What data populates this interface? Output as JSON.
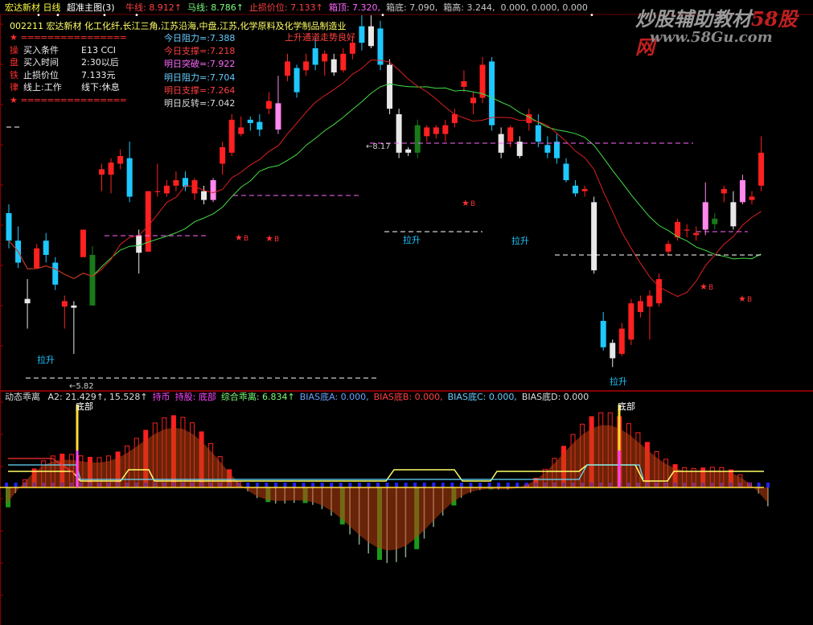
{
  "header": {
    "title": "宏达新材 日线",
    "main_chart_name": "超准主图(3)",
    "indicators": [
      {
        "label": "牛线:",
        "value": "8.912↑",
        "color": "#ff4040"
      },
      {
        "label": "马线:",
        "value": "8.786↑",
        "color": "#7cfc7c"
      },
      {
        "label": "止损价位:",
        "value": "7.133↑",
        "color": "#ff4040"
      },
      {
        "label": "箱顶:",
        "value": "7.320,",
        "color": "#ff66ff"
      },
      {
        "label": "箱底:",
        "value": "7.090,",
        "color": "#c8c8c8"
      },
      {
        "label": "箱高:",
        "value": "3.244,",
        "color": "#c8c8c8"
      },
      {
        "label": "",
        "value": "0.000, 0.000, 0.000",
        "color": "#c8c8c8"
      }
    ]
  },
  "stock_info": {
    "line": "002211 宏达新材 化工化纤,长江三角,江苏沿海,中盘,江苏,化学原料及化学制品制造业",
    "trend_note": "上升通道走势良好"
  },
  "info_panel": {
    "separator": "================",
    "rows": [
      {
        "icon": "操",
        "label": "买入条件",
        "value": "E13 CCI"
      },
      {
        "icon": "盘",
        "label": "买入时间",
        "value": "2:30以后"
      },
      {
        "icon": "铁",
        "label": "止损价位",
        "value": "7.133元"
      },
      {
        "icon": "律",
        "label": "线上:工作",
        "value": "线下:休息"
      }
    ]
  },
  "levels_panel": [
    {
      "text": "今日阻力=:7.388",
      "color": "#66ccff"
    },
    {
      "text": "今日支撑=:7.218",
      "color": "#ff4040"
    },
    {
      "text": "明日突破=:7.922",
      "color": "#ff66ff"
    },
    {
      "text": "明日阻力=:7.704",
      "color": "#66ccff"
    },
    {
      "text": "明日支撑=:7.264",
      "color": "#ff4040"
    },
    {
      "text": "明日反转=:7.042",
      "color": "#dddddd"
    }
  ],
  "price_marks": {
    "high": "8.17",
    "low": "5.82"
  },
  "signal_labels": {
    "lift": "拉升",
    "buy": "B",
    "bottom": "底部"
  },
  "lower_panel": {
    "name": "动态乖离",
    "values": [
      {
        "label": "A2:",
        "value": "21.429↑, 15.528↑",
        "color": "#dddddd"
      },
      {
        "label": "",
        "value": "持币",
        "color": "#ff44ff"
      },
      {
        "label": "持股:",
        "value": "底部",
        "color": "#ff44ff"
      },
      {
        "label": "综合乖离:",
        "value": "6.834↑",
        "color": "#7cfc7c"
      },
      {
        "label": "BIAS底A:",
        "value": "0.000,",
        "color": "#66a3ff"
      },
      {
        "label": "BIAS底B:",
        "value": "0.000,",
        "color": "#ff4040"
      },
      {
        "label": "BIAS底C:",
        "value": "0.000,",
        "color": "#66ccff"
      },
      {
        "label": "BIAS底D:",
        "value": "0.000",
        "color": "#dddddd"
      }
    ]
  },
  "watermark": {
    "text1": "炒股辅助教材",
    "text2": "58股网",
    "url": "www.58Gu.com"
  },
  "chart_data": [
    {
      "type": "candlestick",
      "title": "宏达新材 日线",
      "series_note": "approximate OHLC per day read from candle positions",
      "candles": [
        {
          "o": 7.1,
          "h": 7.18,
          "l": 6.78,
          "c": 6.85,
          "col": "cyan"
        },
        {
          "o": 6.85,
          "h": 6.98,
          "l": 6.6,
          "c": 6.65,
          "col": "cyan"
        },
        {
          "o": 6.32,
          "h": 6.5,
          "l": 6.05,
          "c": 6.28,
          "col": "white"
        },
        {
          "o": 6.78,
          "h": 6.82,
          "l": 6.6,
          "c": 6.6,
          "col": "red"
        },
        {
          "o": 6.85,
          "h": 6.92,
          "l": 6.65,
          "c": 6.72,
          "col": "cyan"
        },
        {
          "o": 6.65,
          "h": 6.7,
          "l": 6.4,
          "c": 6.45,
          "col": "cyan"
        },
        {
          "o": 6.3,
          "h": 6.35,
          "l": 6.05,
          "c": 6.25,
          "col": "red"
        },
        {
          "o": 6.26,
          "h": 6.3,
          "l": 5.82,
          "c": 6.24,
          "col": "white"
        },
        {
          "o": 6.7,
          "h": 6.95,
          "l": 6.7,
          "c": 6.95,
          "col": "red"
        },
        {
          "o": 6.72,
          "h": 6.8,
          "l": 6.26,
          "c": 6.26,
          "col": "green"
        },
        {
          "o": 7.45,
          "h": 7.55,
          "l": 7.3,
          "c": 7.5,
          "col": "red"
        },
        {
          "o": 7.45,
          "h": 7.6,
          "l": 7.28,
          "c": 7.56,
          "col": "red"
        },
        {
          "o": 7.55,
          "h": 7.68,
          "l": 7.5,
          "c": 7.62,
          "col": "red"
        },
        {
          "o": 7.6,
          "h": 7.75,
          "l": 7.2,
          "c": 7.25,
          "col": "cyan"
        },
        {
          "o": 6.74,
          "h": 6.95,
          "l": 6.55,
          "c": 6.9,
          "col": "white"
        },
        {
          "o": 6.75,
          "h": 7.3,
          "l": 6.75,
          "c": 7.3,
          "col": "red"
        },
        {
          "o": 7.3,
          "h": 7.55,
          "l": 7.25,
          "c": 7.3,
          "col": "red"
        },
        {
          "o": 7.28,
          "h": 7.4,
          "l": 7.25,
          "c": 7.35,
          "col": "red"
        },
        {
          "o": 7.35,
          "h": 7.48,
          "l": 7.3,
          "c": 7.4,
          "col": "red"
        },
        {
          "o": 7.42,
          "h": 7.48,
          "l": 7.3,
          "c": 7.34,
          "col": "cyan"
        },
        {
          "o": 7.28,
          "h": 7.42,
          "l": 7.22,
          "c": 7.4,
          "col": "red"
        },
        {
          "o": 7.3,
          "h": 7.35,
          "l": 7.18,
          "c": 7.22,
          "col": "white"
        },
        {
          "o": 7.22,
          "h": 7.42,
          "l": 7.2,
          "c": 7.4,
          "col": "pink"
        },
        {
          "o": 7.7,
          "h": 7.75,
          "l": 7.45,
          "c": 7.55,
          "col": "red"
        },
        {
          "o": 7.65,
          "h": 8.0,
          "l": 7.62,
          "c": 7.95,
          "col": "red"
        },
        {
          "o": 7.88,
          "h": 7.98,
          "l": 7.8,
          "c": 7.82,
          "col": "red"
        },
        {
          "o": 7.92,
          "h": 7.98,
          "l": 7.85,
          "c": 7.95,
          "col": "cyan"
        },
        {
          "o": 7.93,
          "h": 8.0,
          "l": 7.8,
          "c": 7.86,
          "col": "cyan"
        },
        {
          "o": 8.05,
          "h": 8.2,
          "l": 8.0,
          "c": 8.12,
          "col": "red"
        },
        {
          "o": 8.1,
          "h": 8.35,
          "l": 7.82,
          "c": 7.86,
          "col": "pink"
        },
        {
          "o": 8.35,
          "h": 8.55,
          "l": 8.3,
          "c": 8.48,
          "col": "red"
        },
        {
          "o": 8.42,
          "h": 8.45,
          "l": 8.15,
          "c": 8.2,
          "col": "cyan"
        },
        {
          "o": 8.48,
          "h": 8.55,
          "l": 8.35,
          "c": 8.4,
          "col": "red"
        },
        {
          "o": 8.6,
          "h": 8.7,
          "l": 8.4,
          "c": 8.45,
          "col": "cyan"
        },
        {
          "o": 8.48,
          "h": 8.58,
          "l": 8.35,
          "c": 8.55,
          "col": "red"
        },
        {
          "o": 8.5,
          "h": 8.55,
          "l": 8.35,
          "c": 8.38,
          "col": "white"
        },
        {
          "o": 8.4,
          "h": 8.6,
          "l": 8.38,
          "c": 8.55,
          "col": "red"
        },
        {
          "o": 8.55,
          "h": 8.7,
          "l": 8.5,
          "c": 8.65,
          "col": "red"
        },
        {
          "o": 8.8,
          "h": 8.9,
          "l": 8.58,
          "c": 8.65,
          "col": "cyan"
        },
        {
          "o": 8.8,
          "h": 8.9,
          "l": 8.6,
          "c": 8.62,
          "col": "white"
        },
        {
          "o": 8.78,
          "h": 8.85,
          "l": 8.4,
          "c": 8.45,
          "col": "cyan"
        },
        {
          "o": 8.45,
          "h": 8.5,
          "l": 8.0,
          "c": 8.05,
          "col": "white"
        },
        {
          "o": 8.0,
          "h": 8.05,
          "l": 7.6,
          "c": 7.65,
          "col": "white"
        },
        {
          "o": 7.68,
          "h": 7.7,
          "l": 7.62,
          "c": 7.65,
          "col": "white"
        },
        {
          "o": 7.65,
          "h": 7.95,
          "l": 7.6,
          "c": 7.9,
          "col": "green"
        },
        {
          "o": 7.8,
          "h": 7.9,
          "l": 7.75,
          "c": 7.88,
          "col": "red"
        },
        {
          "o": 7.82,
          "h": 7.9,
          "l": 7.78,
          "c": 7.88,
          "col": "red"
        },
        {
          "o": 7.82,
          "h": 7.95,
          "l": 7.75,
          "c": 7.9,
          "col": "red"
        },
        {
          "o": 7.92,
          "h": 8.05,
          "l": 7.88,
          "c": 8.0,
          "col": "red"
        },
        {
          "o": 8.25,
          "h": 8.4,
          "l": 8.2,
          "c": 8.3,
          "col": "red"
        },
        {
          "o": 8.1,
          "h": 8.2,
          "l": 8.0,
          "c": 8.15,
          "col": "red"
        },
        {
          "o": 8.45,
          "h": 8.52,
          "l": 8.1,
          "c": 8.15,
          "col": "red"
        },
        {
          "o": 8.48,
          "h": 8.52,
          "l": 7.85,
          "c": 7.9,
          "col": "cyan"
        },
        {
          "o": 7.82,
          "h": 7.88,
          "l": 7.6,
          "c": 7.65,
          "col": "white"
        },
        {
          "o": 7.75,
          "h": 7.9,
          "l": 7.7,
          "c": 7.88,
          "col": "red"
        },
        {
          "o": 7.75,
          "h": 7.8,
          "l": 7.6,
          "c": 7.62,
          "col": "white"
        },
        {
          "o": 8.0,
          "h": 8.05,
          "l": 7.85,
          "c": 7.92,
          "col": "red"
        },
        {
          "o": 7.9,
          "h": 8.0,
          "l": 7.7,
          "c": 7.75,
          "col": "cyan"
        },
        {
          "o": 7.72,
          "h": 7.8,
          "l": 7.6,
          "c": 7.65,
          "col": "cyan"
        },
        {
          "o": 7.75,
          "h": 7.82,
          "l": 7.55,
          "c": 7.6,
          "col": "cyan"
        },
        {
          "o": 7.55,
          "h": 7.6,
          "l": 7.38,
          "c": 7.4,
          "col": "cyan"
        },
        {
          "o": 7.35,
          "h": 7.4,
          "l": 7.25,
          "c": 7.28,
          "col": "cyan"
        },
        {
          "o": 7.32,
          "h": 7.35,
          "l": 7.25,
          "c": 7.3,
          "col": "red"
        },
        {
          "o": 7.2,
          "h": 7.25,
          "l": 6.55,
          "c": 6.58,
          "col": "white"
        },
        {
          "o": 6.12,
          "h": 6.2,
          "l": 5.85,
          "c": 5.88,
          "col": "cyan"
        },
        {
          "o": 5.92,
          "h": 5.95,
          "l": 5.7,
          "c": 5.78,
          "col": "white"
        },
        {
          "o": 5.82,
          "h": 6.1,
          "l": 5.8,
          "c": 6.05,
          "col": "red"
        },
        {
          "o": 5.95,
          "h": 6.32,
          "l": 5.9,
          "c": 6.28,
          "col": "red"
        },
        {
          "o": 6.2,
          "h": 6.35,
          "l": 6.15,
          "c": 6.3,
          "col": "red"
        },
        {
          "o": 6.25,
          "h": 6.4,
          "l": 5.95,
          "c": 6.35,
          "col": "red"
        },
        {
          "o": 6.28,
          "h": 6.55,
          "l": 6.25,
          "c": 6.5,
          "col": "red"
        },
        {
          "o": 6.75,
          "h": 6.85,
          "l": 6.72,
          "c": 6.82,
          "col": "red"
        },
        {
          "o": 7.02,
          "h": 7.05,
          "l": 6.85,
          "c": 6.88,
          "col": "red"
        },
        {
          "o": 6.95,
          "h": 7.0,
          "l": 6.88,
          "c": 6.95,
          "col": "red"
        },
        {
          "o": 6.92,
          "h": 6.98,
          "l": 6.85,
          "c": 6.9,
          "col": "red"
        },
        {
          "o": 6.95,
          "h": 7.38,
          "l": 6.9,
          "c": 7.2,
          "col": "pink"
        },
        {
          "o": 7.05,
          "h": 7.1,
          "l": 6.95,
          "c": 7.0,
          "col": "green"
        },
        {
          "o": 7.32,
          "h": 7.35,
          "l": 7.2,
          "c": 7.28,
          "col": "red"
        },
        {
          "o": 7.2,
          "h": 7.3,
          "l": 6.95,
          "c": 6.98,
          "col": "white"
        },
        {
          "o": 7.2,
          "h": 7.45,
          "l": 7.18,
          "c": 7.4,
          "col": "pink"
        },
        {
          "o": 7.25,
          "h": 7.3,
          "l": 7.18,
          "c": 7.22,
          "col": "red"
        },
        {
          "o": 7.65,
          "h": 7.8,
          "l": 7.3,
          "c": 7.35,
          "col": "red"
        }
      ],
      "ma_note": "red and green moving averages",
      "ylim": [
        5.6,
        8.6
      ]
    },
    {
      "type": "bar",
      "title": "动态乖离",
      "note": "histogram of bias oscillator; positive above zero line, negative below",
      "ylim": [
        -1,
        1
      ]
    }
  ]
}
